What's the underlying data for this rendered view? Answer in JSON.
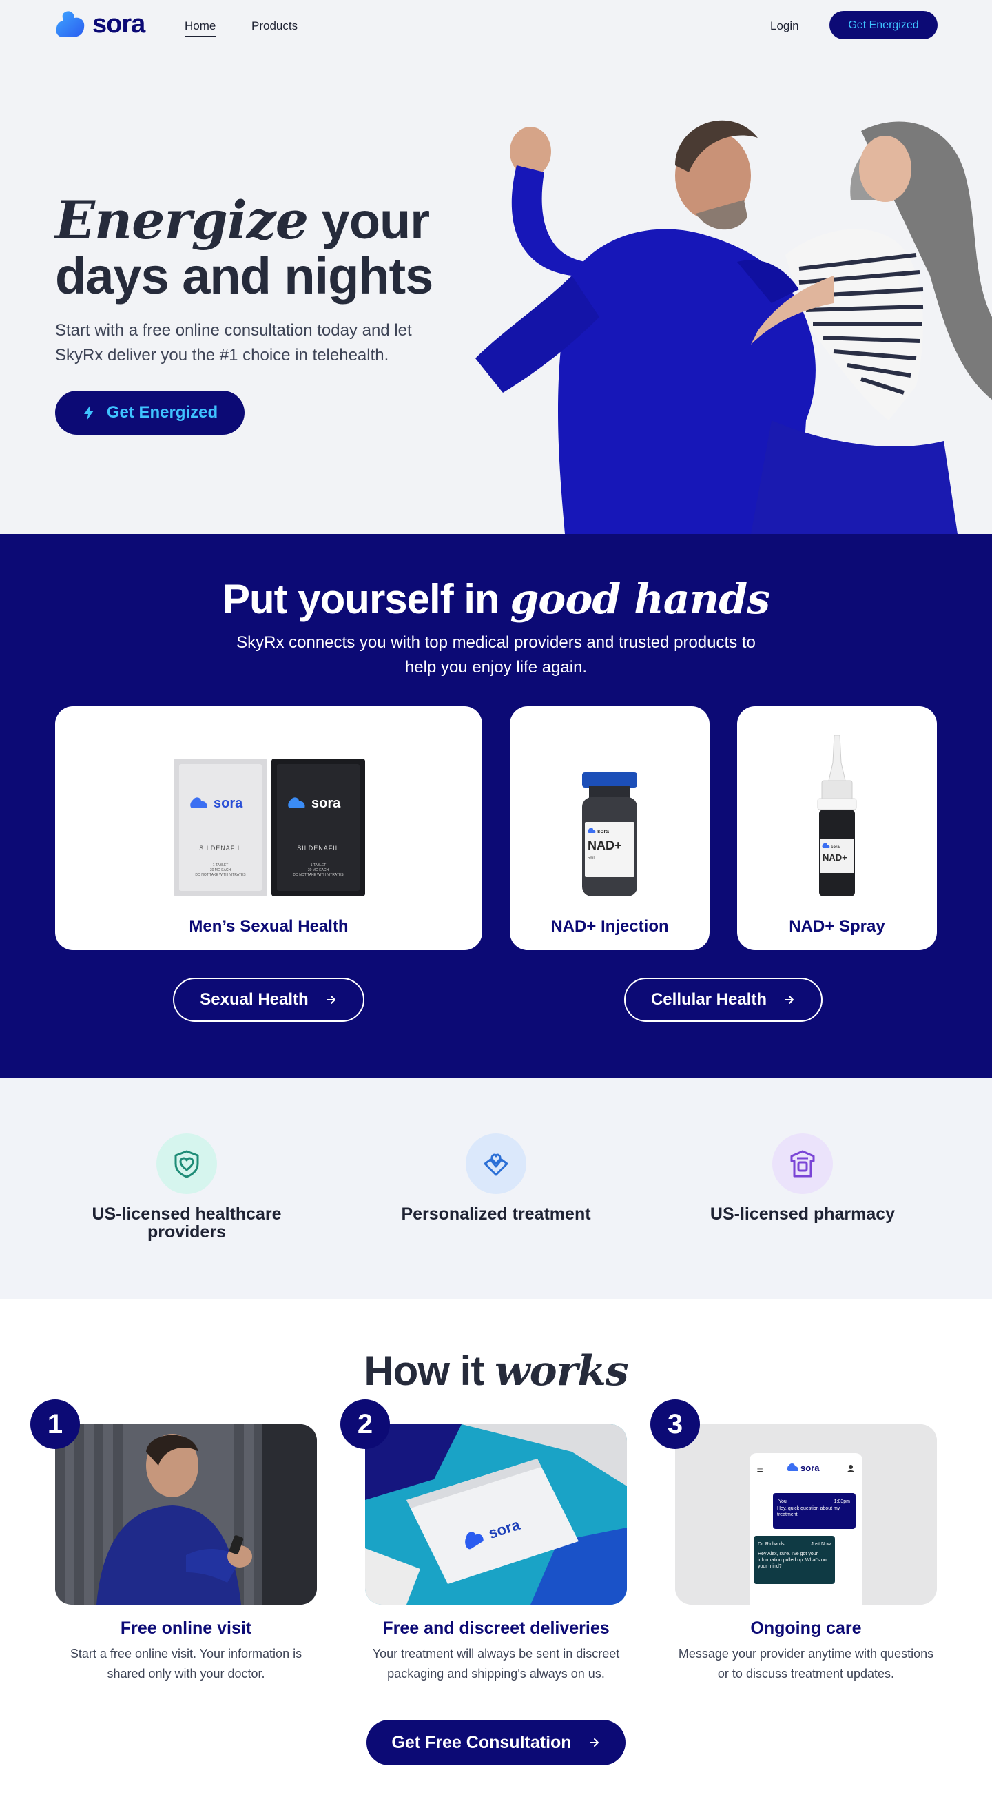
{
  "header": {
    "logo_text": "sora",
    "nav": {
      "home": "Home",
      "products": "Products",
      "login": "Login"
    },
    "cta_label": "Get Energized"
  },
  "hero": {
    "title_italic": "Energize",
    "title_rest_1": "your",
    "title_line_2": "days and nights",
    "subtitle": "Start with a free online consultation today and let SkyRx deliver you the #1 choice in telehealth.",
    "cta_label": "Get Energized"
  },
  "hands": {
    "title_plain": "Put yourself in",
    "title_italic": "good hands",
    "subtitle": "SkyRx connects you with top medical providers and trusted products to help you enjoy life again.",
    "cards": [
      {
        "label": "Men’s Sexual Health",
        "pack_brand": "sora",
        "pack_text": "SILDENAFIL",
        "pack_small_1": "1 TABLET",
        "pack_small_2": "30 MG EACH",
        "pack_small_3": "DO NOT TAKE WITH NITRATES"
      },
      {
        "label": "NAD+ Injection",
        "vial_brand": "sora",
        "vial_text": "NAD+",
        "vial_small": "5mL"
      },
      {
        "label": "NAD+ Spray",
        "spray_brand": "sora",
        "spray_text": "NAD+"
      }
    ],
    "buttons": [
      {
        "label": "Sexual Health"
      },
      {
        "label": "Cellular Health"
      }
    ]
  },
  "features": [
    {
      "label": "US-licensed healthcare providers",
      "icon": "shield-heart-icon",
      "bg": "#d6f5ee",
      "color": "#1e8c77"
    },
    {
      "label": "Personalized treatment",
      "icon": "hands-heart-icon",
      "bg": "#dbe8fb",
      "color": "#2b6fd6"
    },
    {
      "label": "US-licensed pharmacy",
      "icon": "pharmacy-icon",
      "bg": "#ebe3fb",
      "color": "#7a45d6"
    }
  ],
  "how": {
    "title_plain": "How it",
    "title_italic": "works",
    "steps": [
      {
        "number": "1",
        "title": "Free online visit",
        "desc": "Start a free online visit. Your information is shared only with your doctor."
      },
      {
        "number": "2",
        "title": "Free and discreet deliveries",
        "desc": "Your treatment will always be sent in discreet packaging and shipping's always on us.",
        "package_brand": "sora"
      },
      {
        "number": "3",
        "title": "Ongoing care",
        "desc": "Message your provider anytime with questions or to discuss treatment updates.",
        "phone": {
          "brand": "sora",
          "msg1_from": "You",
          "msg1_time": "1:03pm",
          "msg1_text": "Hey, quick question about my treatment",
          "msg2_from": "Dr. Richards",
          "msg2_time": "Just Now",
          "msg2_text": "Hey Alex, sure. I've got your information pulled up. What's on your mind?"
        }
      }
    ],
    "cta_label": "Get Free Consultation"
  },
  "colors": {
    "navy": "#0c0a75",
    "accent": "#3fc3ff",
    "hero_bg": "#f2f3f6",
    "features_bg": "#f1f3f8"
  }
}
